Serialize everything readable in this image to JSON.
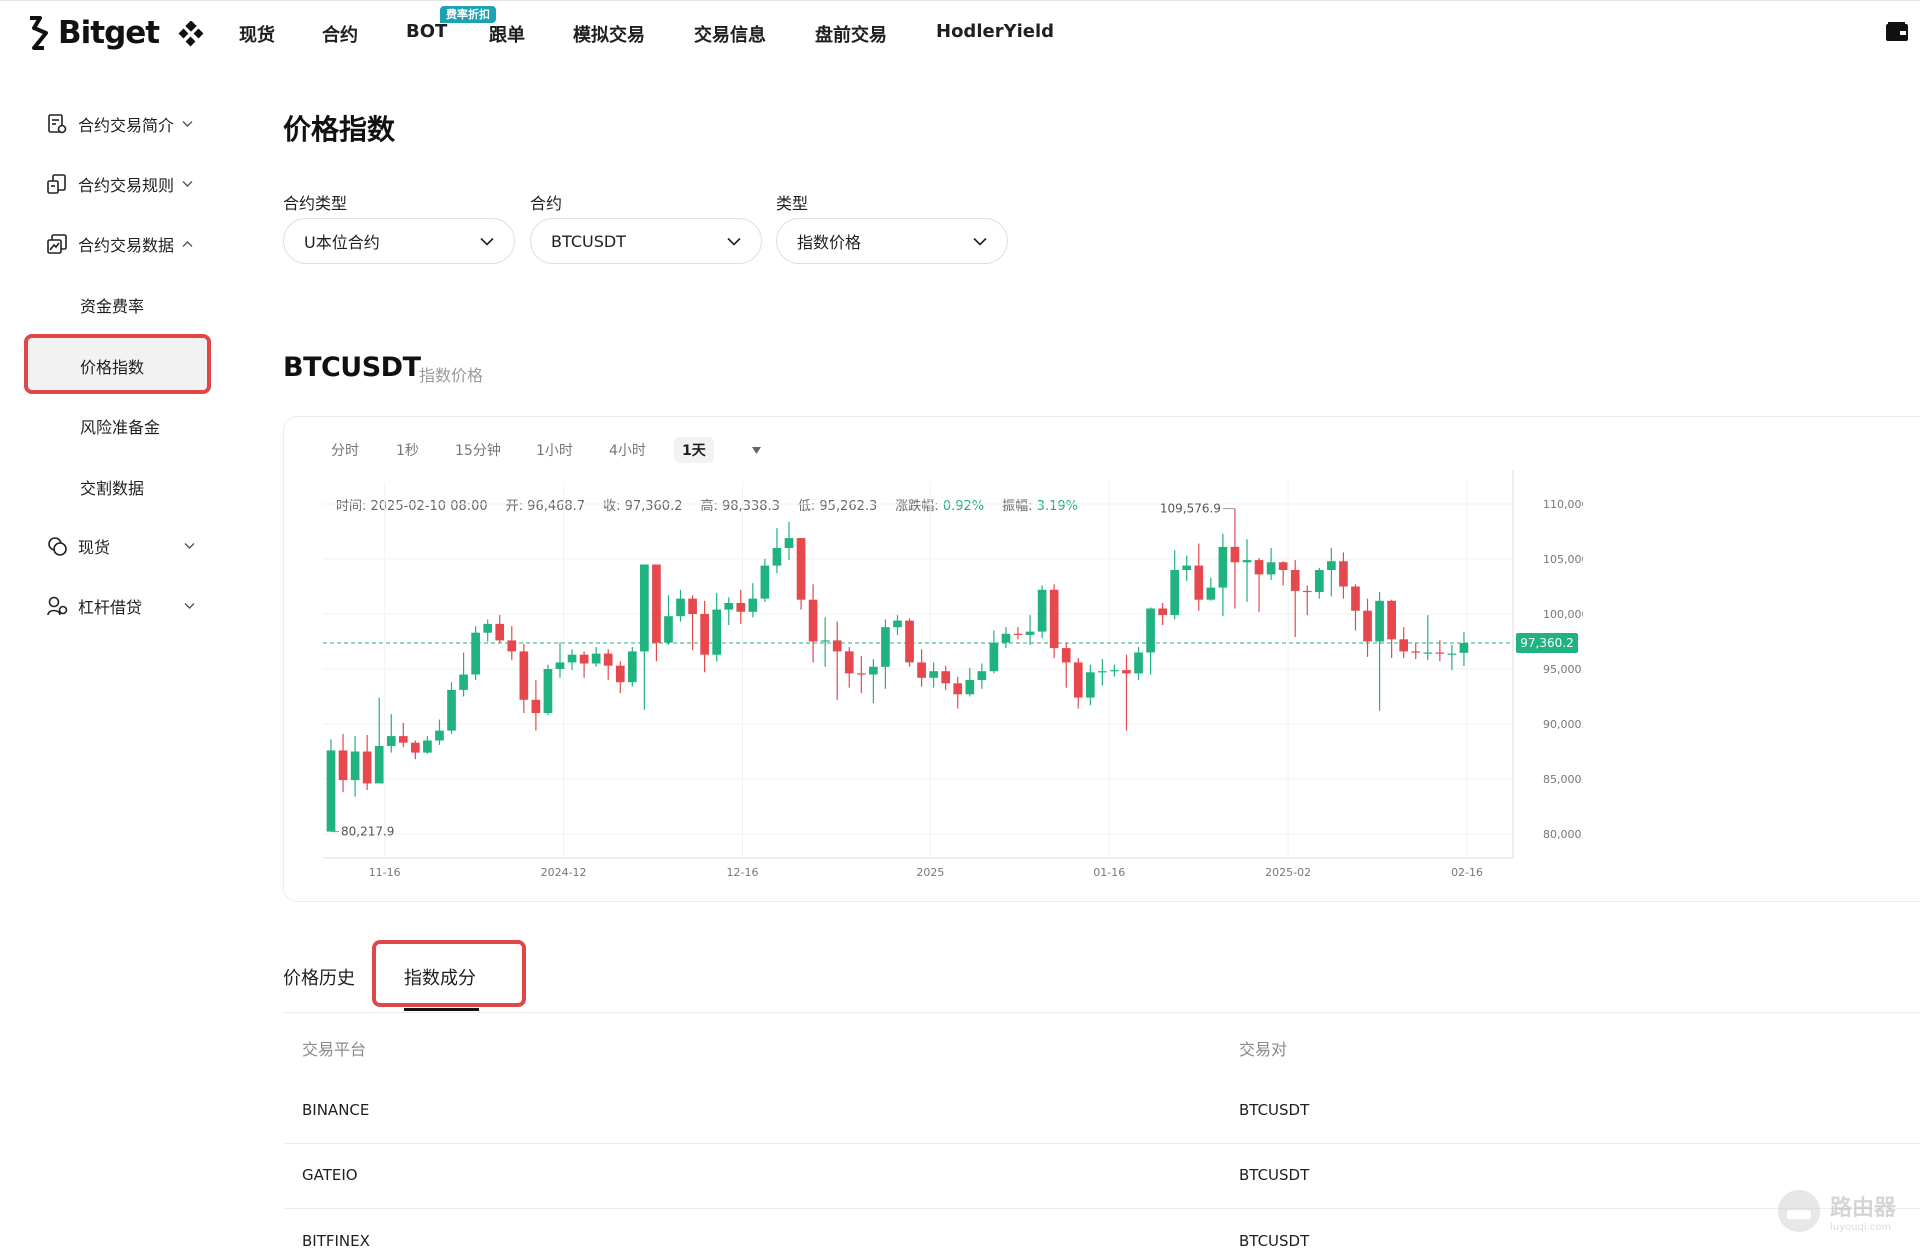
{
  "brand": {
    "name": "Bitget"
  },
  "nav": {
    "items": [
      "现货",
      "合约",
      "BOT",
      "跟单",
      "模拟交易",
      "交易信息",
      "盘前交易",
      "HodlerYield"
    ],
    "badge": "费率折扣"
  },
  "sidebar": {
    "groups": [
      {
        "label": "合约交易简介",
        "icon": "document-settings-icon",
        "expanded": false
      },
      {
        "label": "合约交易规则",
        "icon": "rules-document-icon",
        "expanded": false
      },
      {
        "label": "合约交易数据",
        "icon": "chart-data-icon",
        "expanded": true
      },
      {
        "label": "现货",
        "icon": "spot-coins-icon",
        "expanded": false
      },
      {
        "label": "杠杆借贷",
        "icon": "margin-loan-icon",
        "expanded": false
      }
    ],
    "sub_items": [
      "资金费率",
      "价格指数",
      "风险准备金",
      "交割数据"
    ],
    "active": "价格指数"
  },
  "page": {
    "title": "价格指数",
    "filters": [
      {
        "label": "合约类型",
        "value": "U本位合约"
      },
      {
        "label": "合约",
        "value": "BTCUSDT"
      },
      {
        "label": "类型",
        "value": "指数价格"
      }
    ],
    "symbol": "BTCUSDT",
    "symbol_sub": "指数价格"
  },
  "chart_toolbar": {
    "intervals": [
      "分时",
      "1秒",
      "15分钟",
      "1小时",
      "4小时",
      "1天"
    ],
    "active": "1天"
  },
  "ohlc_info": {
    "time": "时间: 2025-02-10 08:00",
    "open": "开: 96,468.7",
    "close": "收: 97,360.2",
    "high": "高: 98,338.3",
    "low": "低: 95,262.3",
    "change_label": "涨跌幅:",
    "change_value": "0.92%",
    "amp_label": "振幅:",
    "amp_value": "3.19%"
  },
  "chart_data": {
    "type": "candlestick",
    "ylim": [
      78000,
      112000
    ],
    "y_ticks": [
      "110,000.0",
      "105,000.0",
      "100,000.0",
      "95,000.0",
      "90,000.0",
      "85,000.0",
      "80,000.0"
    ],
    "y_tick_values": [
      110000,
      105000,
      100000,
      95000,
      90000,
      85000,
      80000
    ],
    "x_ticks": [
      "11-16",
      "2024-12",
      "12-16",
      "2025",
      "01-16",
      "2025-02",
      "02-16"
    ],
    "current_price": 97360.2,
    "current_price_label": "97,360.2",
    "max_label": "109,576.9",
    "min_label": "80,217.9",
    "colors": {
      "up": "#20b27f",
      "down": "#e5484d",
      "grid": "#f2f2f2"
    },
    "candles": [
      [
        80217.9,
        87600,
        88600,
        80217.9
      ],
      [
        87600,
        84900,
        89100,
        83800
      ],
      [
        84900,
        87500,
        88900,
        83400
      ],
      [
        87500,
        84600,
        89000,
        84000
      ],
      [
        84600,
        88000,
        92400,
        85600
      ],
      [
        88000,
        88900,
        90900,
        87400
      ],
      [
        88900,
        88300,
        90100,
        87900
      ],
      [
        88300,
        87400,
        88500,
        86800
      ],
      [
        87400,
        88500,
        88900,
        87300
      ],
      [
        88500,
        89400,
        90400,
        88100
      ],
      [
        89400,
        93100,
        93800,
        89100
      ],
      [
        93100,
        94500,
        96500,
        92500
      ],
      [
        94500,
        98300,
        98900,
        94000
      ],
      [
        98300,
        99100,
        99500,
        97500
      ],
      [
        99100,
        97600,
        99900,
        97400
      ],
      [
        97600,
        96600,
        98900,
        95800
      ],
      [
        96600,
        92200,
        97300,
        91000
      ],
      [
        92200,
        91000,
        94000,
        89400
      ],
      [
        91000,
        95000,
        95400,
        90800
      ],
      [
        95000,
        95600,
        97400,
        94200
      ],
      [
        95600,
        96300,
        96800,
        94900
      ],
      [
        96300,
        95500,
        96600,
        94200
      ],
      [
        95500,
        96400,
        97000,
        95200
      ],
      [
        96400,
        95300,
        96800,
        94000
      ],
      [
        95300,
        93800,
        95700,
        92800
      ],
      [
        93800,
        96600,
        97000,
        93400
      ],
      [
        96600,
        104500,
        104500,
        91300
      ],
      [
        104500,
        97400,
        100500,
        95700
      ],
      [
        97400,
        99800,
        101700,
        97200
      ],
      [
        99800,
        101400,
        102200,
        99300
      ],
      [
        101400,
        100000,
        101700,
        96700
      ],
      [
        100000,
        96300,
        101200,
        94700
      ],
      [
        96300,
        100400,
        101900,
        95700
      ],
      [
        100400,
        101000,
        101500,
        99000
      ],
      [
        101000,
        100200,
        102200,
        99100
      ],
      [
        100200,
        101400,
        102800,
        99700
      ],
      [
        101400,
        104400,
        105000,
        101100
      ],
      [
        104400,
        106000,
        107800,
        103700
      ],
      [
        106000,
        106900,
        108400,
        104900
      ],
      [
        106900,
        101300,
        106900,
        100400
      ],
      [
        101300,
        97500,
        102700,
        95600
      ],
      [
        97500,
        97600,
        99700,
        95200
      ],
      [
        97600,
        96600,
        99300,
        92200
      ],
      [
        96600,
        94600,
        97000,
        93300
      ],
      [
        94600,
        94500,
        96200,
        92800
      ],
      [
        94500,
        95200,
        95900,
        91900
      ],
      [
        95200,
        98800,
        99500,
        93200
      ],
      [
        98800,
        99400,
        99900,
        98100
      ],
      [
        99400,
        95600,
        99600,
        95200
      ],
      [
        95600,
        94200,
        96800,
        93400
      ],
      [
        94200,
        94800,
        95600,
        93300
      ],
      [
        94800,
        93700,
        95300,
        93100
      ],
      [
        93700,
        92700,
        94300,
        91400
      ],
      [
        92700,
        94000,
        95100,
        92500
      ],
      [
        94000,
        94800,
        95500,
        93200
      ],
      [
        94800,
        97400,
        98500,
        94600
      ],
      [
        97400,
        98200,
        98800,
        96900
      ],
      [
        98200,
        98100,
        98800,
        97700
      ],
      [
        98100,
        98400,
        99900,
        97200
      ],
      [
        98400,
        102200,
        102600,
        97800
      ],
      [
        102200,
        96900,
        102700,
        96000
      ],
      [
        96900,
        95600,
        97400,
        93300
      ],
      [
        95600,
        92400,
        96000,
        91400
      ],
      [
        92400,
        94700,
        95400,
        91700
      ],
      [
        94700,
        94800,
        95900,
        93500
      ],
      [
        94800,
        94900,
        95400,
        94300
      ],
      [
        94900,
        94600,
        96300,
        89400
      ],
      [
        94600,
        96500,
        97000,
        94000
      ],
      [
        96500,
        100500,
        100600,
        94500
      ],
      [
        100500,
        99900,
        101000,
        99000
      ],
      [
        99900,
        104000,
        105800,
        99500
      ],
      [
        104000,
        104400,
        105300,
        103000
      ],
      [
        104400,
        101300,
        106400,
        100300
      ],
      [
        101300,
        102400,
        103300,
        101200
      ],
      [
        102400,
        106100,
        107300,
        99800
      ],
      [
        106100,
        104700,
        109576.9,
        100500
      ],
      [
        104700,
        104900,
        106800,
        101100
      ],
      [
        104900,
        103600,
        105100,
        100200
      ],
      [
        103600,
        104700,
        106000,
        103100
      ],
      [
        104700,
        104000,
        104800,
        102600
      ],
      [
        104000,
        102100,
        104900,
        97900
      ],
      [
        102100,
        102000,
        102600,
        99900
      ],
      [
        102000,
        104000,
        104200,
        101400
      ],
      [
        104000,
        104800,
        106000,
        101600
      ],
      [
        104800,
        102500,
        105600,
        101400
      ],
      [
        102500,
        100300,
        102700,
        98500
      ],
      [
        100300,
        97500,
        101400,
        96100
      ],
      [
        97500,
        101200,
        102000,
        91200
      ],
      [
        101200,
        97700,
        101300,
        96000
      ],
      [
        97700,
        96600,
        98800,
        96000
      ],
      [
        96600,
        96500,
        97400,
        95900
      ],
      [
        96500,
        96500,
        99900,
        95800
      ],
      [
        96500,
        96400,
        97600,
        95700
      ],
      [
        96400,
        96400,
        97200,
        94900
      ],
      [
        96468.7,
        97360.2,
        98338.3,
        95262.3
      ]
    ]
  },
  "tabs": [
    "价格历史",
    "指数成分"
  ],
  "active_tab": "指数成分",
  "table": {
    "headers": [
      "交易平台",
      "交易对"
    ],
    "rows": [
      [
        "BINANCE",
        "BTCUSDT"
      ],
      [
        "GATEIO",
        "BTCUSDT"
      ],
      [
        "BITFINEX",
        "BTCUSDT"
      ]
    ]
  },
  "watermark": {
    "text": "路由器",
    "sub": "luyouqi.com"
  }
}
